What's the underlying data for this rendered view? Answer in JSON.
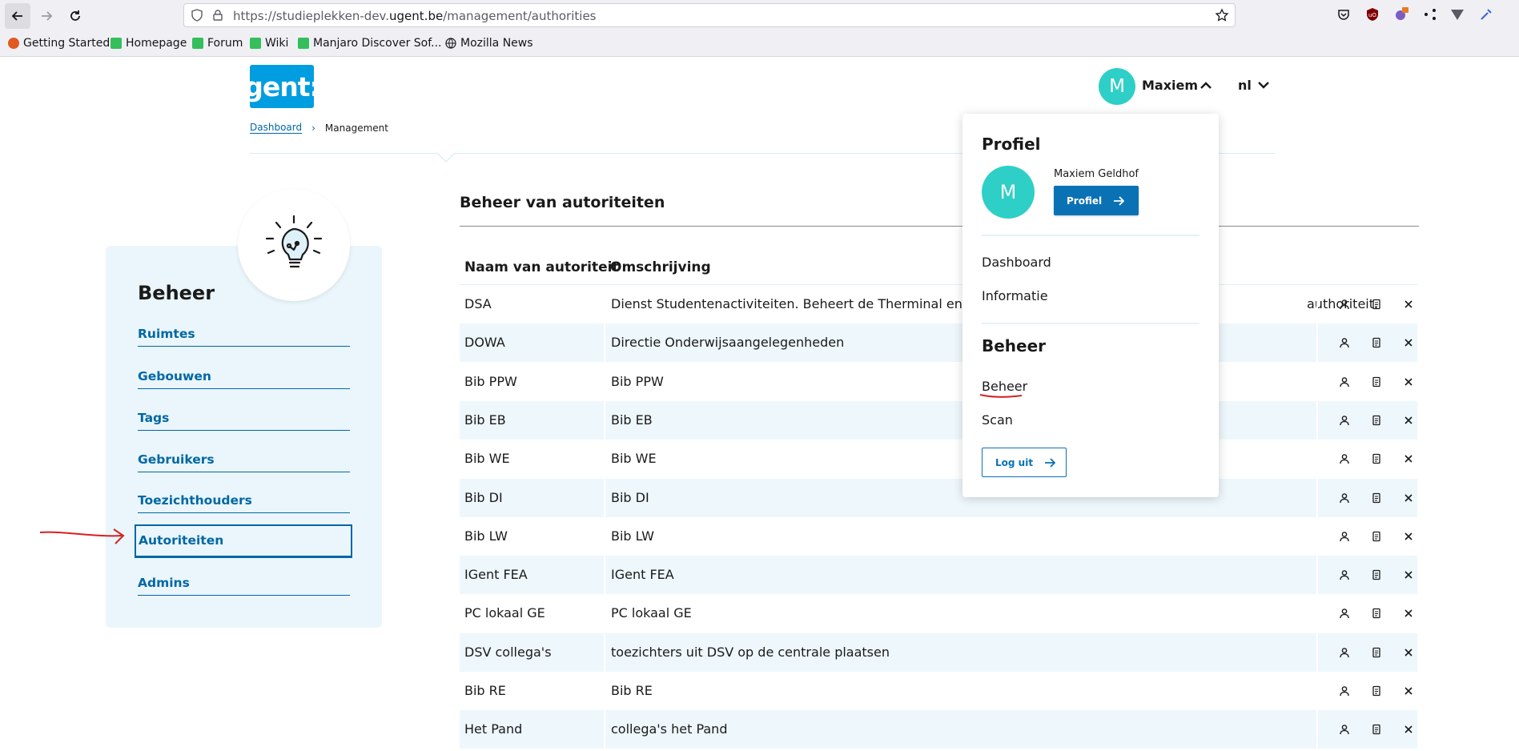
{
  "browser": {
    "url_prefix": "https://studieplekken-dev.",
    "url_domain": "ugent.be",
    "url_path": "/management/authorities",
    "bookmarks": [
      "Getting Started",
      "Homepage",
      "Forum",
      "Wiki",
      "Manjaro Discover Sof...",
      "Mozilla News"
    ]
  },
  "header": {
    "logo_text": "gent:",
    "user_initial": "M",
    "user_name": "Maxiem",
    "language": "nl"
  },
  "breadcrumb": {
    "home": "Dashboard",
    "current": "Management"
  },
  "sidebar": {
    "title": "Beheer",
    "items": [
      "Ruimtes",
      "Gebouwen",
      "Tags",
      "Gebruikers",
      "Toezichthouders",
      "Autoriteiten",
      "Admins"
    ],
    "active": "Autoriteiten"
  },
  "main": {
    "title": "Beheer van autoriteiten",
    "columns": [
      "Naam van autoriteit",
      "Omschrijving"
    ],
    "rows": [
      {
        "name": "DSA",
        "desc_left": "Dienst Studentenactiviteiten. Beheert de Therminal en alles v",
        "desc_right": "authoriteit."
      },
      {
        "name": "DOWA",
        "desc_left": "Directie Onderwijsaangelegenheden",
        "desc_right": ""
      },
      {
        "name": "Bib PPW",
        "desc_left": "Bib PPW",
        "desc_right": ""
      },
      {
        "name": "Bib EB",
        "desc_left": "Bib EB",
        "desc_right": ""
      },
      {
        "name": "Bib WE",
        "desc_left": "Bib WE",
        "desc_right": ""
      },
      {
        "name": "Bib DI",
        "desc_left": "Bib DI",
        "desc_right": ""
      },
      {
        "name": "Bib LW",
        "desc_left": "Bib LW",
        "desc_right": ""
      },
      {
        "name": "IGent FEA",
        "desc_left": "IGent FEA",
        "desc_right": ""
      },
      {
        "name": "PC lokaal GE",
        "desc_left": "PC lokaal GE",
        "desc_right": ""
      },
      {
        "name": "DSV collega's",
        "desc_left": "toezichters uit DSV op de centrale plaatsen",
        "desc_right": ""
      },
      {
        "name": "Bib RE",
        "desc_left": "Bib RE",
        "desc_right": ""
      },
      {
        "name": "Het Pand",
        "desc_left": "collega's het Pand",
        "desc_right": ""
      }
    ]
  },
  "dropdown": {
    "profile_title": "Profiel",
    "avatar_initial": "M",
    "full_name": "Maxiem Geldhof",
    "profile_button": "Profiel",
    "links_top": [
      "Dashboard",
      "Informatie"
    ],
    "management_title": "Beheer",
    "links_bottom": [
      "Beheer",
      "Scan"
    ],
    "logout_button": "Log uit"
  },
  "colors": {
    "accent": "#0067a5",
    "avatar": "#2ecfc6",
    "logo": "#009de0",
    "row_alt": "#eef7fc",
    "annotation": "#d62020"
  }
}
